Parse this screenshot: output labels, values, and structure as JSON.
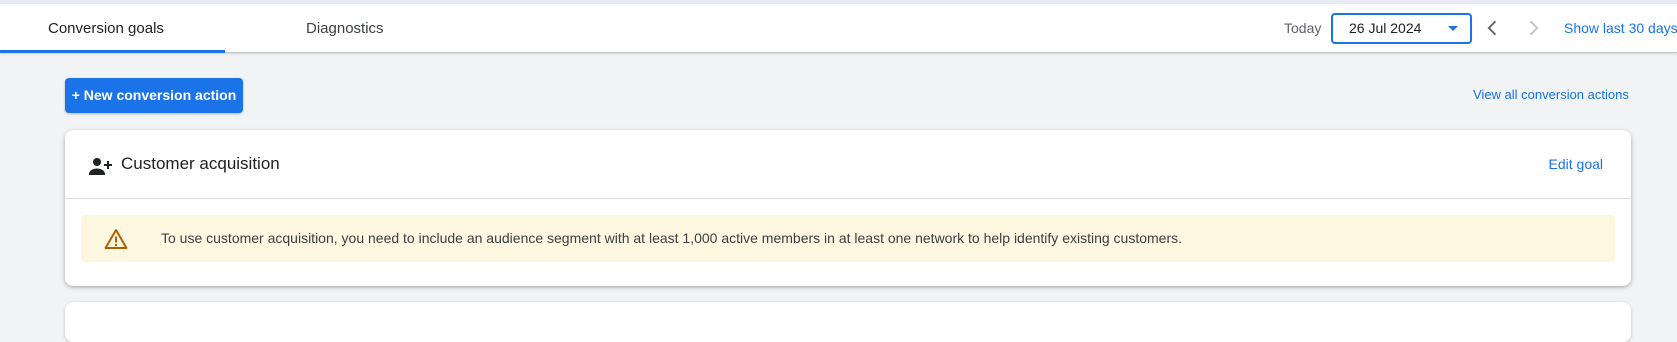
{
  "tabs": [
    {
      "label": "Conversion goals",
      "active": true
    },
    {
      "label": "Diagnostics",
      "active": false
    }
  ],
  "date_range": {
    "label": "Today",
    "selected": "26 Jul 2024",
    "show_last_label": "Show last 30 days",
    "prev_icon": "chevron-left-icon",
    "next_icon": "chevron-right-icon"
  },
  "actions": {
    "new_conversion_label": "+ New conversion action",
    "view_all_label": "View all conversion actions"
  },
  "goal_card": {
    "icon": "person-add-icon",
    "title": "Customer acquisition",
    "edit_label": "Edit goal",
    "warning": {
      "icon": "warning-icon",
      "text": "To use customer acquisition, you need to include an audience segment with at least 1,000 active members in at least one network to help identify existing customers."
    }
  },
  "colors": {
    "accent": "#1a73e8",
    "background": "#f1f3f4",
    "warning_bg": "#fef7e0",
    "warning_icon": "#b06000"
  }
}
